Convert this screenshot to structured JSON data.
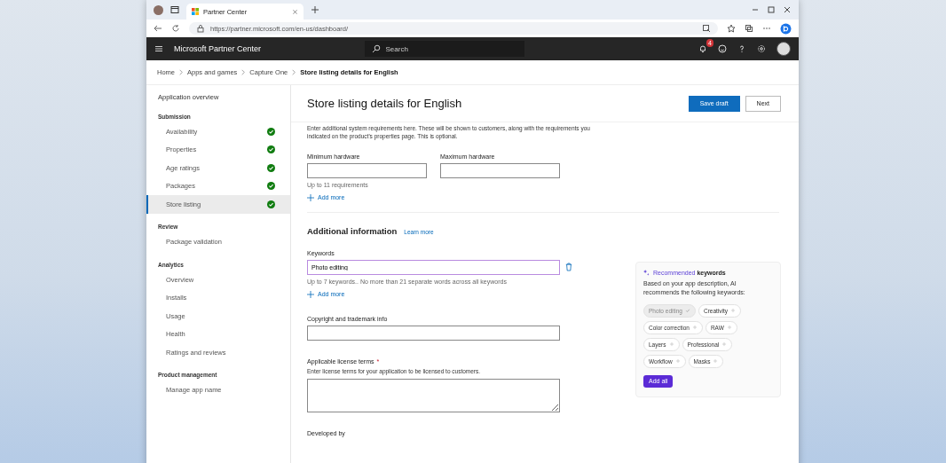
{
  "browser": {
    "tab_title": "Partner Center",
    "url": "https://partner.microsoft.com/en-us/dashboard/"
  },
  "header": {
    "title": "Microsoft Partner Center",
    "search_placeholder": "Search",
    "notification_count": "4"
  },
  "breadcrumb": [
    {
      "label": "Home"
    },
    {
      "label": "Apps and games"
    },
    {
      "label": "Capture One"
    },
    {
      "label": "Store listing details for English",
      "current": true
    }
  ],
  "sidebar": {
    "top_item": "Application overview",
    "sections": [
      {
        "title": "Submission",
        "items": [
          {
            "label": "Availability",
            "done": true,
            "selected": false
          },
          {
            "label": "Properties",
            "done": true,
            "selected": false
          },
          {
            "label": "Age ratings",
            "done": true,
            "selected": false
          },
          {
            "label": "Packages",
            "done": true,
            "selected": false
          },
          {
            "label": "Store listing",
            "done": true,
            "selected": true
          }
        ]
      },
      {
        "title": "Review",
        "items": [
          {
            "label": "Package validation",
            "done": false,
            "selected": false
          }
        ]
      },
      {
        "title": "Analytics",
        "items": [
          {
            "label": "Overview",
            "done": false,
            "selected": false
          },
          {
            "label": "Installs",
            "done": false,
            "selected": false
          },
          {
            "label": "Usage",
            "done": false,
            "selected": false
          },
          {
            "label": "Health",
            "done": false,
            "selected": false
          },
          {
            "label": "Ratings and reviews",
            "done": false,
            "selected": false
          }
        ]
      },
      {
        "title": "Product management",
        "items": [
          {
            "label": "Manage app name",
            "done": false,
            "selected": false
          }
        ]
      }
    ]
  },
  "page": {
    "title": "Store listing details for English",
    "buttons": [
      {
        "label": "Save draft",
        "kind": "primary"
      },
      {
        "label": "Next",
        "kind": "secondary"
      }
    ],
    "requirements_text": "Enter additional system requirements here. These will be shown to customers, along with the requirements you indicated on the product's properties page. This is optional.",
    "hardware_fields": [
      {
        "label": "Minimum hardware"
      },
      {
        "label": "Maximum hardware"
      }
    ],
    "hardware_hint": "Up to 11 requirements",
    "add_more_1": "Add more",
    "additional_title": "Additional information",
    "learn_more": "Learn more",
    "keywords_label": "Keywords",
    "keywords_value": "Photo editing",
    "keywords_hint": "Up to 7 keywords.. No more than 21 separate words across all keywords",
    "add_more_2": "Add more",
    "copyright_label": "Copyright and trademark info",
    "license_label": "Applicable license terms",
    "license_required": "*",
    "license_hint": "Enter license terms for your application to be licensed to customers.",
    "developed_by_label": "Developed by"
  },
  "recommended": {
    "title_accent": "Recommended",
    "title_rest": "keywords",
    "description": "Based on your app description, AI recommends the following keywords:",
    "chips": [
      {
        "label": "Photo editing",
        "selected": true
      },
      {
        "label": "Creativity",
        "selected": false
      },
      {
        "label": "Color correction",
        "selected": false
      },
      {
        "label": "RAW",
        "selected": false
      },
      {
        "label": "Layers",
        "selected": false
      },
      {
        "label": "Professional",
        "selected": false
      },
      {
        "label": "Workflow",
        "selected": false
      },
      {
        "label": "Masks",
        "selected": false
      }
    ],
    "button": "Add all"
  }
}
